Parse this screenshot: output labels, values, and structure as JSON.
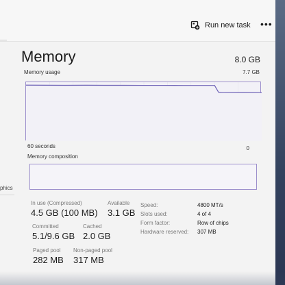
{
  "toolbar": {
    "run_new_task_label": "Run new task",
    "run_new_task_icon": "run-task-icon",
    "more_label": "•••"
  },
  "sidebar": {
    "partial_item": "phics"
  },
  "memory": {
    "title": "Memory",
    "total": "8.0 GB",
    "usage_label": "Memory usage",
    "usage_max": "7.7 GB",
    "time_span_label": "60 seconds",
    "time_end_label": "0",
    "composition_label": "Memory composition"
  },
  "chart_data": {
    "type": "line",
    "x": [
      60,
      55,
      50,
      45,
      40,
      35,
      30,
      25,
      20,
      15,
      12,
      11,
      10,
      5,
      0
    ],
    "values": [
      7.32,
      7.31,
      7.3,
      7.31,
      7.3,
      7.3,
      7.29,
      7.29,
      7.28,
      7.28,
      7.28,
      6.4,
      6.35,
      6.36,
      6.34
    ],
    "ylim": [
      0,
      7.7
    ],
    "xlim": [
      60,
      0
    ],
    "line_color": "#6b5fb5",
    "fill_color": "#f2f1f7",
    "grid": true
  },
  "stats": {
    "in_use": {
      "label": "In use (Compressed)",
      "value": "4.5 GB (100 MB)"
    },
    "available": {
      "label": "Available",
      "value": "3.1 GB"
    },
    "committed": {
      "label": "Committed",
      "value": "5.1/9.6 GB"
    },
    "cached": {
      "label": "Cached",
      "value": "2.0 GB"
    },
    "paged_pool": {
      "label": "Paged pool",
      "value": "282 MB"
    },
    "non_paged_pool": {
      "label": "Non-paged pool",
      "value": "317 MB"
    }
  },
  "properties": [
    {
      "key": "Speed:",
      "value": "4800 MT/s"
    },
    {
      "key": "Slots used:",
      "value": "4 of 4"
    },
    {
      "key": "Form factor:",
      "value": "Row of chips"
    },
    {
      "key": "Hardware reserved:",
      "value": "307 MB"
    }
  ]
}
